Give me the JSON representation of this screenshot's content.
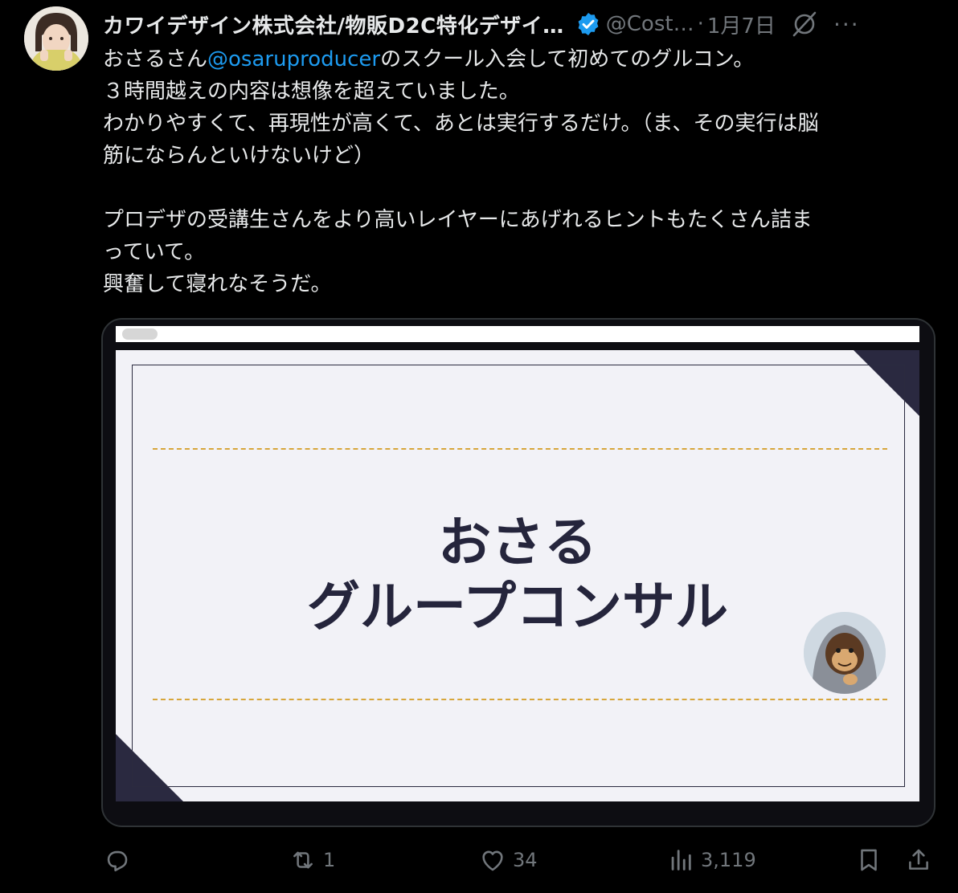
{
  "post": {
    "author_name": "カワイデザイン株式会社/物販D2C特化デザイ…",
    "handle": "@Cost…",
    "separator": "·",
    "date": "1月7日",
    "more": "···",
    "text": {
      "line1_a": "おさるさん",
      "line1_mention": "@osaruproducer",
      "line1_b": "のスクール入会して初めてのグルコン。",
      "line2": "３時間越えの内容は想像を超えていました。",
      "line3": "わかりやすくて、再現性が高くて、あとは実行するだけ。（ま、その実行は脳",
      "line4": "筋にならんといけないけど）",
      "line5": "プロデザの受講生さんをより高いレイヤーにあげれるヒントもたくさん詰ま",
      "line6": "っていて。",
      "line7": "興奮して寝れなそうだ。"
    }
  },
  "media": {
    "slide_title_line1": "おさる",
    "slide_title_line2": "グループコンサル"
  },
  "actions": {
    "reply_count": "",
    "repost_count": "1",
    "like_count": "34",
    "views_count": "3,119"
  },
  "icons": {
    "verified": "verified-badge-icon",
    "grok": "grok-icon",
    "reply": "reply-icon",
    "repost": "repost-icon",
    "like": "heart-icon",
    "views": "views-bar-chart-icon",
    "bookmark": "bookmark-icon",
    "share": "share-icon"
  },
  "colors": {
    "background": "#000000",
    "text": "#e7e9ea",
    "muted": "#71767b",
    "link": "#1d9bf0",
    "slide_title": "#25253c",
    "slide_dash": "#d7a63b",
    "slide_corner": "#2a2940"
  }
}
